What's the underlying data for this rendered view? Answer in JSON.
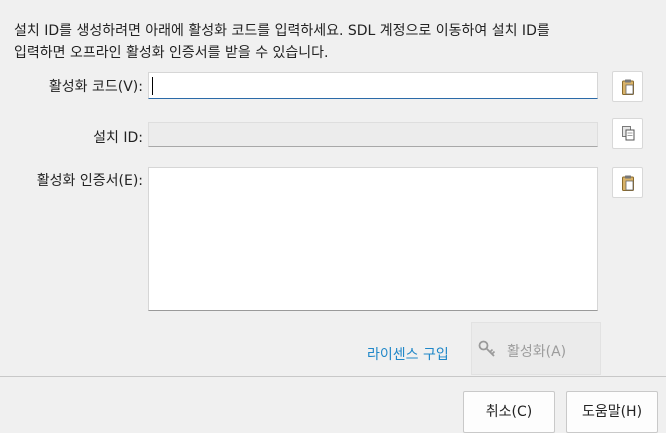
{
  "intro": {
    "line1": "설치 ID를 생성하려면 아래에 활성화 코드를 입력하세요. SDL 계정으로 이동하여 설치 ID를",
    "line2": "입력하면 오프라인 활성화 인증서를 받을 수 있습니다."
  },
  "form": {
    "activation_code_label": "활성화 코드(V):",
    "activation_code_value": "",
    "install_id_label": "설치 ID:",
    "install_id_value": "",
    "certificate_label": "활성화 인증서(E):",
    "certificate_value": ""
  },
  "icons": {
    "paste": "clipboard-paste-icon",
    "copy": "copy-icon",
    "key": "key-icon"
  },
  "actions": {
    "buy_license_link": "라이센스 구입",
    "activate_button": "활성화(A)",
    "cancel_button": "취소(C)",
    "help_button": "도움말(H)"
  }
}
